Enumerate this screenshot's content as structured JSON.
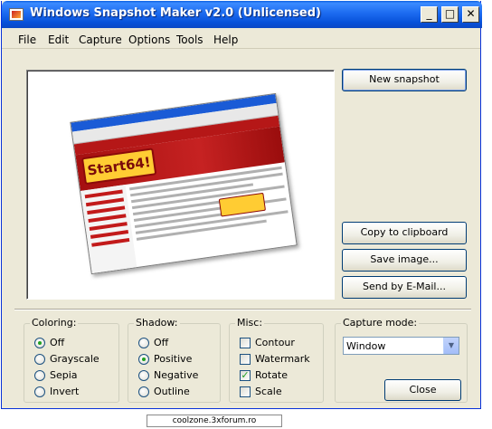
{
  "window": {
    "title": "Windows Snapshot Maker v2.0 (Unlicensed)"
  },
  "titlebar_buttons": {
    "minimize": "_",
    "maximize": "□",
    "close": "✕"
  },
  "menu": [
    "File",
    "Edit",
    "Capture",
    "Options",
    "Tools",
    "Help"
  ],
  "preview": {
    "logo_text": "Start64!"
  },
  "buttons": {
    "new_snapshot": "New snapshot",
    "copy": "Copy to clipboard",
    "save": "Save image...",
    "email": "Send by E-Mail...",
    "close": "Close"
  },
  "coloring": {
    "label": "Coloring:",
    "options": [
      "Off",
      "Grayscale",
      "Sepia",
      "Invert"
    ],
    "selected": "Off"
  },
  "shadow": {
    "label": "Shadow:",
    "options": [
      "Off",
      "Positive",
      "Negative",
      "Outline"
    ],
    "selected": "Positive"
  },
  "misc": {
    "label": "Misc:",
    "options": [
      "Contour",
      "Watermark",
      "Rotate",
      "Scale"
    ],
    "checked": [
      "Rotate"
    ]
  },
  "capture_mode": {
    "label": "Capture mode:",
    "value": "Window"
  },
  "footer": {
    "text": "coolzone.3xforum.ro"
  }
}
